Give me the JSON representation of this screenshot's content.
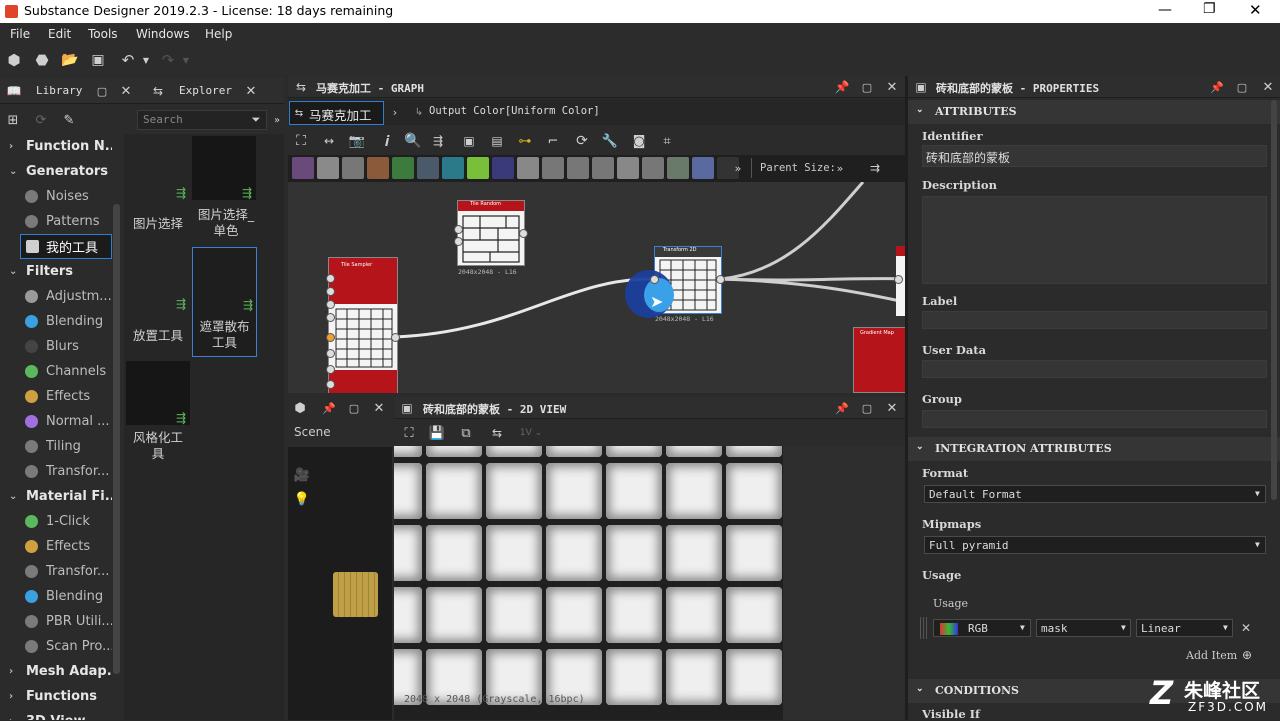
{
  "window": {
    "title": "Substance Designer 2019.2.3 - License: 18 days remaining"
  },
  "menu": [
    "File",
    "Edit",
    "Tools",
    "Windows",
    "Help"
  ],
  "library": {
    "tab_library": "Library",
    "tab_explorer": "Explorer",
    "search_placeholder": "Search",
    "items": [
      {
        "label": "Function N...",
        "kind": "cat",
        "arrow": "›"
      },
      {
        "label": "Generators",
        "kind": "cat",
        "arrow": "⌄"
      },
      {
        "label": "Noises",
        "kind": "item",
        "color": "#7a7a7a"
      },
      {
        "label": "Patterns",
        "kind": "item",
        "color": "#7a7a7a"
      },
      {
        "label": "我的工具",
        "kind": "sel",
        "color": "#cfcfcf"
      },
      {
        "label": "Filters",
        "kind": "cat",
        "arrow": "⌄"
      },
      {
        "label": "Adjustm...",
        "kind": "item",
        "color": "#9a9a9a"
      },
      {
        "label": "Blending",
        "kind": "item",
        "color": "#3aa0e0"
      },
      {
        "label": "Blurs",
        "kind": "item",
        "color": "#444"
      },
      {
        "label": "Channels",
        "kind": "item",
        "color": "#5cb85c"
      },
      {
        "label": "Effects",
        "kind": "item",
        "color": "#d0a040"
      },
      {
        "label": "Normal ...",
        "kind": "item",
        "color": "#a070e0"
      },
      {
        "label": "Tiling",
        "kind": "item",
        "color": "#7a7a7a"
      },
      {
        "label": "Transfor...",
        "kind": "item",
        "color": "#7a7a7a"
      },
      {
        "label": "Material Fi...",
        "kind": "cat",
        "arrow": "⌄"
      },
      {
        "label": "1-Click",
        "kind": "item",
        "color": "#5cb85c"
      },
      {
        "label": "Effects",
        "kind": "item",
        "color": "#d0a040"
      },
      {
        "label": "Transfor...",
        "kind": "item",
        "color": "#7a7a7a"
      },
      {
        "label": "Blending",
        "kind": "item",
        "color": "#3aa0e0"
      },
      {
        "label": "PBR Utili...",
        "kind": "item",
        "color": "#7a7a7a"
      },
      {
        "label": "Scan Pro...",
        "kind": "item",
        "color": "#7a7a7a"
      },
      {
        "label": "Mesh Adap...",
        "kind": "cat",
        "arrow": "›"
      },
      {
        "label": "Functions",
        "kind": "cat",
        "arrow": "›"
      },
      {
        "label": "3D View",
        "kind": "cat",
        "arrow": "›"
      }
    ],
    "thumbs": [
      {
        "label": "图片选择"
      },
      {
        "label": "图片选择_\n单色"
      },
      {
        "label": "放置工具"
      },
      {
        "label": "遮罩散布\n工具"
      },
      {
        "label": "风格化工\n具"
      }
    ]
  },
  "graph": {
    "title": "马赛克加工 - GRAPH",
    "tab": "马赛克加工",
    "breadcrumb": "Output Color[Uniform Color]",
    "parent_size": "Parent Size:",
    "nodes": {
      "tile_random": "Tile Random",
      "tile_random_size": "2048x2048 - L16",
      "tile_sampler": "Tile Sampler",
      "transform": "Transform 2D",
      "transform_size": "2048x2048 - L16",
      "gradient": "Gradient Map"
    }
  },
  "view2d": {
    "title": "砖和底部的蒙板 - 2D VIEW",
    "scene_label": "Scene",
    "status": "2048 x 2048 (Grayscale, 16bpc)"
  },
  "properties": {
    "title": "砖和底部的蒙板 - PROPERTIES",
    "section_attributes": "ATTRIBUTES",
    "identifier_label": "Identifier",
    "identifier_value": "砖和底部的蒙板",
    "description_label": "Description",
    "label_label": "Label",
    "userdata_label": "User Data",
    "group_label": "Group",
    "section_integration": "INTEGRATION ATTRIBUTES",
    "format_label": "Format",
    "format_value": "Default Format",
    "mipmaps_label": "Mipmaps",
    "mipmaps_value": "Full pyramid",
    "usage_label": "Usage",
    "usage_sub_label": "Usage",
    "usage_channel": "RGB",
    "usage_name": "mask",
    "usage_space": "Linear",
    "add_item": "Add Item",
    "section_conditions": "CONDITIONS",
    "visible_if_label": "Visible If"
  },
  "watermark": {
    "text": "朱峰社区",
    "sub": "ZF3D.COM"
  },
  "colors": {
    "accent": "#2f7fd1",
    "node_red": "#b5141a",
    "bg": "#2b2b2b"
  }
}
